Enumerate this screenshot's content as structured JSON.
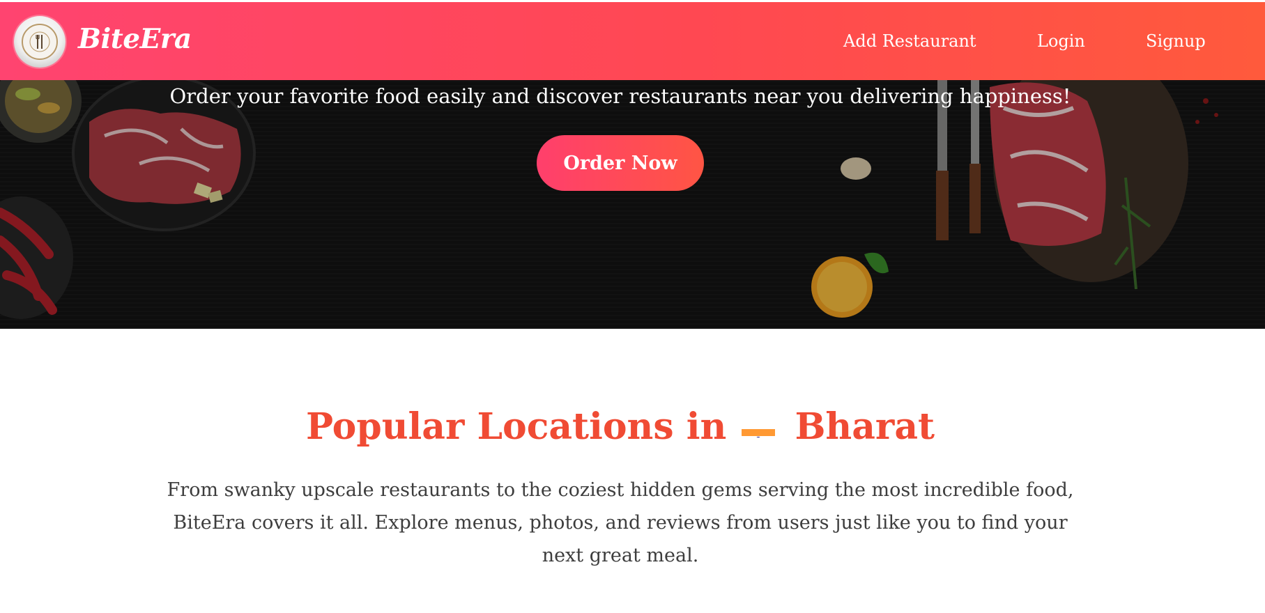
{
  "navbar": {
    "brand": "BiteEra",
    "links": [
      "Add Restaurant",
      "Login",
      "Signup"
    ],
    "gradient_colors": [
      "#ff4470",
      "#ff5a3c"
    ]
  },
  "hero": {
    "tagline": "Order your favorite food easily and discover restaurants near you delivering happiness!",
    "cta_label": "Order Now"
  },
  "locations": {
    "title_prefix": "Popular Locations in",
    "title_suffix": "Bharat",
    "flag_icon": "india-flag-icon",
    "description": "From swanky upscale restaurants to the coziest hidden gems serving the most incredible food, BiteEra covers it all. Explore menus, photos, and reviews from users just like you to find your next great meal.",
    "accent_color": "#f04b34"
  }
}
